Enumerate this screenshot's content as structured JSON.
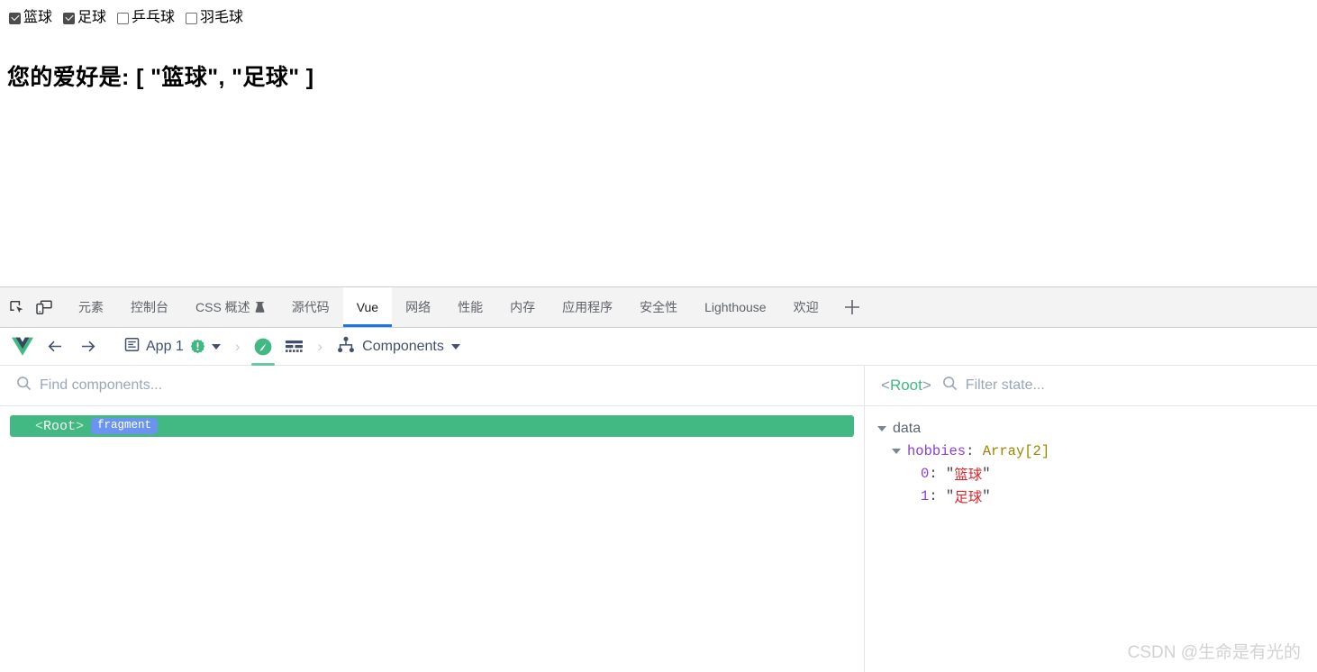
{
  "page": {
    "checkbox_group_name": "hobbies",
    "checkboxes": [
      {
        "label": "篮球",
        "checked": true,
        "icon": "checkbox-checked-icon"
      },
      {
        "label": "足球",
        "checked": true,
        "icon": "checkbox-checked-icon"
      },
      {
        "label": "乒乓球",
        "checked": false,
        "icon": "checkbox-unchecked-icon"
      },
      {
        "label": "羽毛球",
        "checked": false,
        "icon": "checkbox-unchecked-icon"
      }
    ],
    "heading": "您的爱好是: [ \"篮球\", \"足球\" ]"
  },
  "devtools": {
    "left_icons": [
      {
        "name": "inspect-element-icon"
      },
      {
        "name": "device-toolbar-icon"
      }
    ],
    "tabs": [
      {
        "label": "元素",
        "active": false,
        "icon": null
      },
      {
        "label": "控制台",
        "active": false,
        "icon": null
      },
      {
        "label": "CSS 概述",
        "active": false,
        "icon": "flask-icon"
      },
      {
        "label": "源代码",
        "active": false,
        "icon": null
      },
      {
        "label": "Vue",
        "active": true,
        "icon": null
      },
      {
        "label": "网络",
        "active": false,
        "icon": null
      },
      {
        "label": "性能",
        "active": false,
        "icon": null
      },
      {
        "label": "内存",
        "active": false,
        "icon": null
      },
      {
        "label": "应用程序",
        "active": false,
        "icon": null
      },
      {
        "label": "安全性",
        "active": false,
        "icon": null
      },
      {
        "label": "Lighthouse",
        "active": false,
        "icon": null
      },
      {
        "label": "欢迎",
        "active": false,
        "icon": null
      }
    ],
    "add_tab_icon": "plus-icon",
    "accent_color": "#1a73e8",
    "tabstrip_bg": "#f3f3f3"
  },
  "vue_devtools": {
    "logo_icon": "vue-logo-icon",
    "back_icon": "arrow-left-icon",
    "forward_icon": "arrow-right-icon",
    "app_selector": {
      "icon": "app-window-icon",
      "label": "App 1",
      "badge_icon": "warning-seal-icon",
      "dropdown_icon": "chevron-down-icon"
    },
    "toolbar_icons": [
      {
        "name": "inspector-compass-icon",
        "active": true
      },
      {
        "name": "timeline-bars-icon",
        "active": false
      }
    ],
    "view_selector": {
      "icon": "component-tree-icon",
      "label": "Components",
      "dropdown_icon": "chevron-down-icon"
    },
    "accent_green": "#42b883",
    "components_panel": {
      "search": {
        "icon": "search-icon",
        "placeholder": "Find components...",
        "value": ""
      },
      "tree": [
        {
          "name": "<Root>",
          "tag_open": "<",
          "tag_name": "Root",
          "tag_close": ">",
          "badge": "fragment",
          "selected": true
        }
      ]
    },
    "state_panel": {
      "selected_component": "<Root>",
      "selected_open": "<",
      "selected_name": "Root",
      "selected_close": ">",
      "search": {
        "icon": "search-icon",
        "placeholder": "Filter state...",
        "value": ""
      },
      "groups": [
        {
          "label": "data",
          "expanded": true,
          "entries": [
            {
              "key": "hobbies",
              "type": "Array[2]",
              "expanded": true,
              "items": [
                {
                  "index": "0",
                  "value": "篮球"
                },
                {
                  "index": "1",
                  "value": "足球"
                }
              ]
            }
          ]
        }
      ]
    }
  },
  "watermark": "CSDN @生命是有光的"
}
